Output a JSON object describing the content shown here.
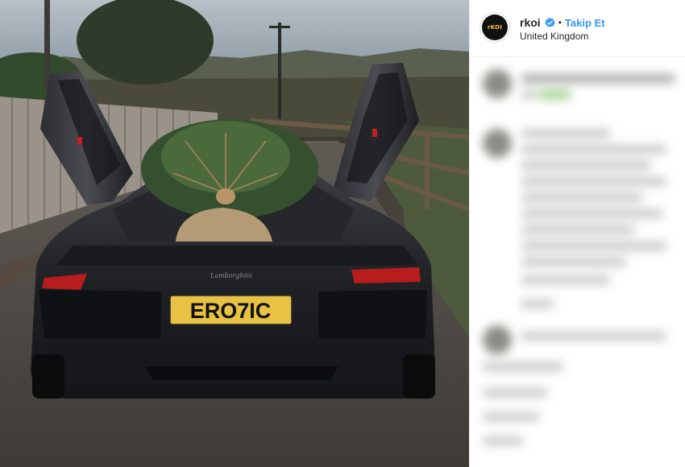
{
  "post": {
    "image_alt": "",
    "license_plate": "ERO7IC",
    "car_badge": "Lamborghini"
  },
  "header": {
    "avatar_text": "rKOI",
    "username": "rkoi",
    "separator": "•",
    "follow_label": "Takip Et",
    "location": "United Kingdom",
    "verified_icon": "verified-badge-icon"
  },
  "colors": {
    "follow": "#3897f0",
    "verified": "#3897f0",
    "plate": "#e7c243"
  }
}
